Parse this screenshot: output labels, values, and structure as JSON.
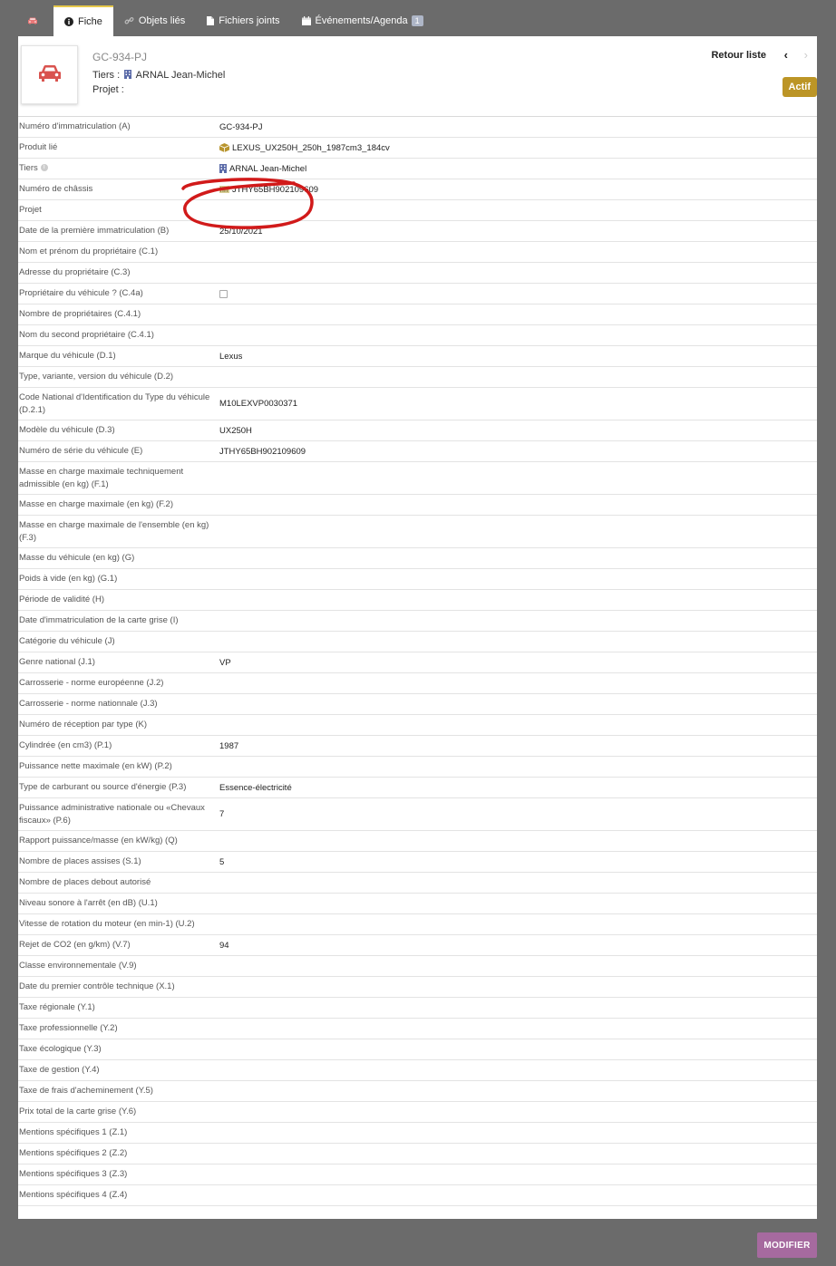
{
  "tabs": [
    {
      "label": "",
      "icon": "car-icon"
    },
    {
      "label": "Fiche",
      "icon": "info-icon"
    },
    {
      "label": "Objets liés",
      "icon": "link-icon"
    },
    {
      "label": "Fichiers joints",
      "icon": "file-icon"
    },
    {
      "label": "Événements/Agenda",
      "icon": "calendar-icon",
      "badge": "1"
    }
  ],
  "header": {
    "ref": "GC-934-PJ",
    "tiers_label": "Tiers :",
    "tiers_value": "ARNAL Jean-Michel",
    "projet_label": "Projet :",
    "back_label": "Retour liste",
    "prev_glyph": "‹",
    "next_glyph": "›",
    "status": "Actif",
    "photo_icon": "car-icon"
  },
  "rows": [
    {
      "label": "Numéro d'immatriculation (A)",
      "value": "GC-934-PJ"
    },
    {
      "label": "Produit lié",
      "value": "LEXUS_UX250H_250h_1987cm3_184cv",
      "icon": "product-cube-icon"
    },
    {
      "label": "Tiers",
      "value": "ARNAL Jean-Michel",
      "icon": "building-icon",
      "info": true
    },
    {
      "label": "Numéro de châssis",
      "value": "JTHY65BH902109609",
      "icon": "barcode-icon"
    },
    {
      "label": "Projet",
      "value": ""
    },
    {
      "label": "Date de la première immatriculation (B)",
      "value": "25/10/2021"
    },
    {
      "label": "Nom et prénom du propriétaire (C.1)",
      "value": ""
    },
    {
      "label": "Adresse du propriétaire (C.3)",
      "value": ""
    },
    {
      "label": "Propriétaire du véhicule ? (C.4a)",
      "value": "",
      "checkbox": true
    },
    {
      "label": "Nombre de propriétaires (C.4.1)",
      "value": ""
    },
    {
      "label": "Nom du second propriétaire (C.4.1)",
      "value": ""
    },
    {
      "label": "Marque du véhicule (D.1)",
      "value": "Lexus"
    },
    {
      "label": "Type, variante, version du véhicule (D.2)",
      "value": ""
    },
    {
      "label": "Code National d'Identification du Type du véhicule (D.2.1)",
      "value": "M10LEXVP0030371",
      "tall": true
    },
    {
      "label": "Modèle du véhicule (D.3)",
      "value": "UX250H"
    },
    {
      "label": "Numéro de série du véhicule (E)",
      "value": "JTHY65BH902109609"
    },
    {
      "label": "Masse en charge maximale techniquement admissible (en kg) (F.1)",
      "value": "",
      "tall": true
    },
    {
      "label": "Masse en charge maximale (en kg) (F.2)",
      "value": ""
    },
    {
      "label": "Masse en charge maximale de l'ensemble (en kg) (F.3)",
      "value": "",
      "tall": true
    },
    {
      "label": "Masse du véhicule (en kg) (G)",
      "value": ""
    },
    {
      "label": "Poids à vide (en kg) (G.1)",
      "value": ""
    },
    {
      "label": "Période de validité (H)",
      "value": ""
    },
    {
      "label": "Date d'immatriculation de la carte grise (I)",
      "value": ""
    },
    {
      "label": "Catégorie du véhicule (J)",
      "value": ""
    },
    {
      "label": "Genre national (J.1)",
      "value": "VP"
    },
    {
      "label": "Carrosserie - norme européenne (J.2)",
      "value": ""
    },
    {
      "label": "Carrosserie - norme nationnale (J.3)",
      "value": ""
    },
    {
      "label": "Numéro de réception par type (K)",
      "value": ""
    },
    {
      "label": "Cylindrée (en cm3) (P.1)",
      "value": "1987"
    },
    {
      "label": "Puissance nette maximale (en kW) (P.2)",
      "value": ""
    },
    {
      "label": "Type de carburant ou source d'énergie (P.3)",
      "value": "Essence-électricité"
    },
    {
      "label": "Puissance administrative nationale ou «Chevaux fiscaux» (P.6)",
      "value": "7",
      "tall": true
    },
    {
      "label": "Rapport puissance/masse (en kW/kg) (Q)",
      "value": ""
    },
    {
      "label": "Nombre de places assises (S.1)",
      "value": "5"
    },
    {
      "label": "Nombre de places debout autorisé",
      "value": ""
    },
    {
      "label": "Niveau sonore à l'arrêt (en dB) (U.1)",
      "value": ""
    },
    {
      "label": "Vitesse de rotation du moteur (en min-1) (U.2)",
      "value": ""
    },
    {
      "label": "Rejet de CO2 (en g/km) (V.7)",
      "value": "94"
    },
    {
      "label": "Classe environnementale (V.9)",
      "value": ""
    },
    {
      "label": "Date du premier contrôle technique (X.1)",
      "value": ""
    },
    {
      "label": "Taxe régionale (Y.1)",
      "value": ""
    },
    {
      "label": "Taxe professionnelle (Y.2)",
      "value": ""
    },
    {
      "label": "Taxe écologique (Y.3)",
      "value": ""
    },
    {
      "label": "Taxe de gestion (Y.4)",
      "value": ""
    },
    {
      "label": "Taxe de frais d'acheminement (Y.5)",
      "value": ""
    },
    {
      "label": "Prix total de la carte grise (Y.6)",
      "value": ""
    },
    {
      "label": "Mentions spécifiques 1 (Z.1)",
      "value": ""
    },
    {
      "label": "Mentions spécifiques 2 (Z.2)",
      "value": ""
    },
    {
      "label": "Mentions spécifiques 3 (Z.3)",
      "value": ""
    },
    {
      "label": "Mentions spécifiques 4 (Z.4)",
      "value": ""
    }
  ],
  "actions": {
    "modify_label": "MODIFIER"
  },
  "colors": {
    "status_bg": "#bc9526",
    "modify_bg": "#a66a9f",
    "car_icon": "#d9534f",
    "annotation": "#d11a1a",
    "tab_active_border": "#e6c84a"
  }
}
